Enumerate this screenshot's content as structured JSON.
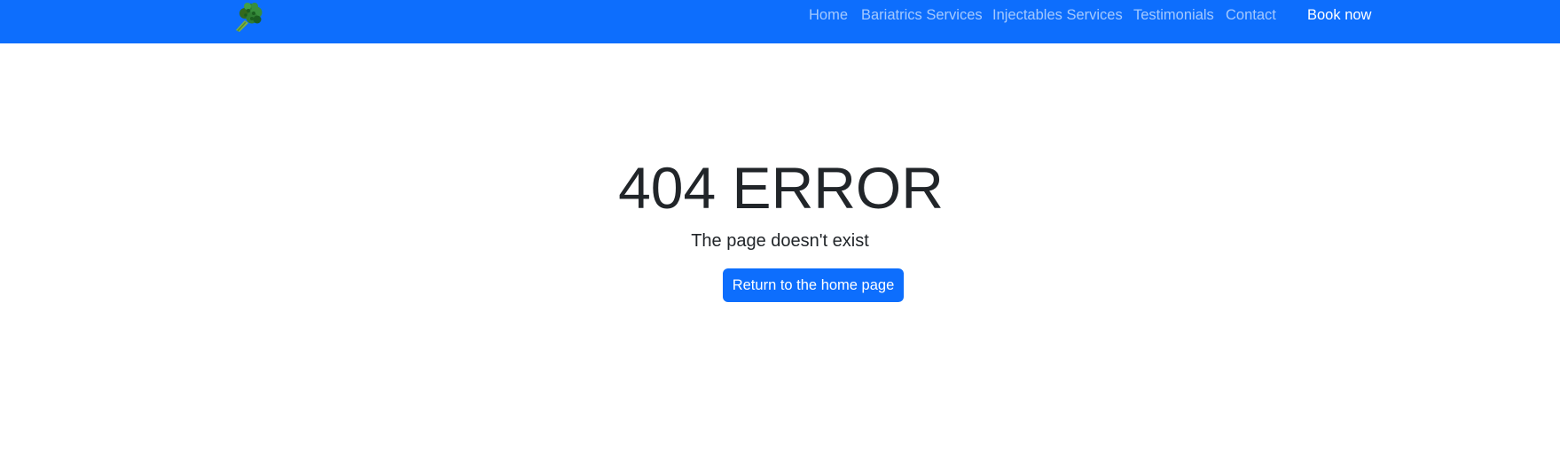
{
  "navbar": {
    "logo_icon": "broccoli-icon",
    "links": [
      {
        "label": "Home"
      },
      {
        "label": "Bariatrics Services"
      },
      {
        "label": "Injectables Services"
      },
      {
        "label": "Testimonials"
      },
      {
        "label": "Contact"
      }
    ],
    "cta_label": "Book now"
  },
  "main": {
    "title": "404 ERROR",
    "subtitle": "The page doesn't exist",
    "button_label": "Return to the home page"
  },
  "colors": {
    "primary": "#0d6efd",
    "text": "#212529",
    "nav_link": "#b5d0fe",
    "background": "#ffffff"
  }
}
